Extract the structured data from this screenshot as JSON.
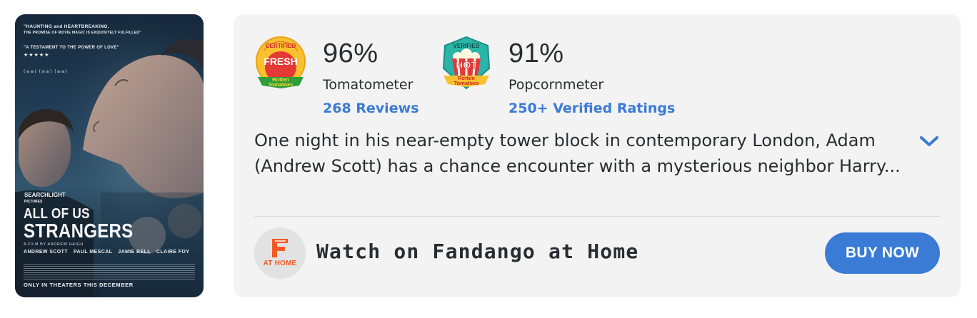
{
  "poster": {
    "review_quote_1": "\"HAUNTING and HEARTBREAKING.",
    "review_quote_1b": "THE PROMISE OF MOVIE MAGIC IS EXQUISITELY FULFILLED\"",
    "review_quote_2": "\"A TESTAMENT TO THE POWER OF LOVE\"",
    "stars": "★★★★★",
    "studio_line1": "SEARCHLIGHT",
    "studio_line2": "PICTURES",
    "title_line1": "ALL OF US",
    "title_line2": "STRANGERS",
    "byline": "A FILM BY ANDREW HAIGH",
    "cast": [
      "ANDREW SCOTT",
      "PAUL MESCAL",
      "JAMIE BELL",
      "CLAIRE FOY"
    ],
    "tagline": "ONLY IN THEATERS THIS DECEMBER"
  },
  "scores": {
    "tomatometer": {
      "badge_icon": "certified-fresh-icon",
      "value": "96%",
      "label": "Tomatometer",
      "link": "268 Reviews"
    },
    "popcornmeter": {
      "badge_icon": "verified-hot-icon",
      "value": "91%",
      "label": "Popcornmeter",
      "link": "250+ Verified Ratings"
    }
  },
  "synopsis": "One night in his near-empty tower block in contemporary London, Adam (Andrew Scott) has a chance encounter with a mysterious neighbor Harry...",
  "expand_icon": "chevron-down-icon",
  "watch": {
    "logo_text": "AT HOME",
    "label": "Watch on Fandango at Home",
    "button": "BUY NOW"
  },
  "colors": {
    "accent_blue": "#3a7bd5",
    "card_bg": "#f3f3f3",
    "fandango_orange": "#f15a24"
  }
}
